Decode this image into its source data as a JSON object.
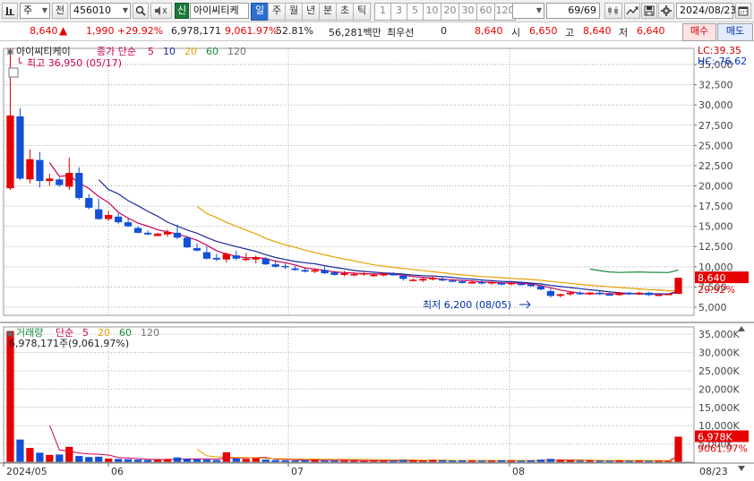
{
  "toolbar": {
    "left_icon": "chart-type-icon",
    "market_select": "주",
    "prev_btn": "전",
    "code": "456010",
    "sound_icon": "speaker-icon",
    "credit_badge": "신",
    "name": "아이씨티케",
    "periods": [
      "일",
      "주",
      "월",
      "년",
      "분",
      "초",
      "틱"
    ],
    "active_period": "일",
    "intervals": [
      "1",
      "3",
      "5",
      "10",
      "20",
      "30",
      "60",
      "120"
    ],
    "count": "69/69",
    "date": "2024/08/23"
  },
  "quote": {
    "price": "8,640",
    "arrow": "▲",
    "change": "1,990",
    "change_pct": "+29.92%",
    "volume": "6,978,171",
    "volume_ratio": "9,061.97%",
    "turnover": "52.81%",
    "amount": "56,281백만",
    "pref_label": "최우선",
    "pref_value": "0",
    "bid_price": "8,640",
    "open_label": "시",
    "open": "6,650",
    "high_label": "고",
    "high": "8,640",
    "low_label": "저",
    "low": "6,640",
    "buy_btn": "매수",
    "sell_btn": "매도"
  },
  "price_panel": {
    "title": "아이씨티케이",
    "ma_label": "종가 단순",
    "ma_periods": [
      "5",
      "10",
      "20",
      "60",
      "120"
    ],
    "ma_colors": [
      "#cc0055",
      "#1a2a9e",
      "#e6a000",
      "#1a8a3a",
      "#707070"
    ],
    "high_note": "최고 36,950 (05/17)",
    "low_note": "최저 6,200 (08/05)",
    "lc": "LC:39.35",
    "hc": "HC:-76.62",
    "y_ticks": [
      "35,000",
      "32,500",
      "30,000",
      "27,500",
      "25,000",
      "22,500",
      "20,000",
      "17,500",
      "15,000",
      "12,500",
      "10,000",
      "7,500",
      "5,000"
    ],
    "current_tag": "8,640",
    "current_pct": "29.92%"
  },
  "volume_panel": {
    "title": "거래량",
    "ma_label": "단순",
    "ma_periods": [
      "5",
      "20",
      "60",
      "120"
    ],
    "volume_note": "6,978,171주(9,061.97%)",
    "y_ticks": [
      "35,000K",
      "30,000K",
      "25,000K",
      "20,000K",
      "15,000K",
      "10,000K",
      "5,000K"
    ],
    "current_tag": "6,978K",
    "current_pct": "9061.97%"
  },
  "x_axis": {
    "labels": [
      "2024/05",
      "06",
      "07",
      "08"
    ],
    "right_label": "08/23"
  },
  "colors": {
    "up": "#e60000",
    "down": "#1150d8"
  },
  "chart_data": {
    "type": "candlestick",
    "title": "아이씨티케이",
    "x_labels": [
      "2024/05",
      "06",
      "07",
      "08"
    ],
    "price_ylim": [
      4000,
      37000
    ],
    "volume_ylim": [
      0,
      37000000
    ],
    "candles": [
      [
        19700,
        36950,
        19500,
        28700
      ],
      [
        28600,
        29600,
        20700,
        20900
      ],
      [
        20800,
        24500,
        20300,
        23300
      ],
      [
        23200,
        24200,
        19800,
        20600
      ],
      [
        20600,
        21500,
        20000,
        20900
      ],
      [
        20800,
        21000,
        19900,
        20100
      ],
      [
        19900,
        23500,
        19500,
        21600
      ],
      [
        21600,
        22300,
        18300,
        18500
      ],
      [
        18500,
        19000,
        17100,
        17300
      ],
      [
        17100,
        18400,
        15800,
        15900
      ],
      [
        15900,
        16900,
        15700,
        16400
      ],
      [
        16200,
        16600,
        15300,
        15500
      ],
      [
        15500,
        16000,
        14900,
        15000
      ],
      [
        14800,
        15000,
        14100,
        14200
      ],
      [
        14200,
        14500,
        13900,
        14000
      ],
      [
        13800,
        14200,
        13800,
        14100
      ],
      [
        14000,
        14600,
        13700,
        14300
      ],
      [
        14200,
        15200,
        13400,
        13600
      ],
      [
        13600,
        13800,
        12300,
        12400
      ],
      [
        12300,
        12900,
        11900,
        12000
      ],
      [
        11800,
        12500,
        10900,
        11000
      ],
      [
        11100,
        11600,
        10700,
        10900
      ],
      [
        10900,
        11800,
        10500,
        11600
      ],
      [
        11400,
        12000,
        10800,
        11000
      ],
      [
        10900,
        11700,
        10700,
        11000
      ],
      [
        10900,
        11400,
        10400,
        11200
      ],
      [
        11000,
        11200,
        10200,
        10300
      ],
      [
        10300,
        10800,
        9900,
        10000
      ],
      [
        10100,
        10400,
        9700,
        10000
      ],
      [
        9800,
        10100,
        9500,
        9600
      ],
      [
        9600,
        9800,
        9300,
        9400
      ],
      [
        9400,
        9800,
        9200,
        9600
      ],
      [
        9600,
        10000,
        9100,
        9200
      ],
      [
        9300,
        9500,
        8900,
        9000
      ],
      [
        9000,
        9500,
        8800,
        9200
      ],
      [
        9100,
        9300,
        8800,
        9100
      ],
      [
        9200,
        9400,
        8900,
        9200
      ],
      [
        9000,
        9200,
        8800,
        9000
      ],
      [
        9000,
        9300,
        8800,
        9100
      ],
      [
        9100,
        9300,
        8900,
        9000
      ],
      [
        8900,
        9100,
        8300,
        8500
      ],
      [
        8400,
        8600,
        8200,
        8400
      ],
      [
        8300,
        8600,
        8100,
        8500
      ],
      [
        8500,
        8800,
        8300,
        8600
      ],
      [
        8500,
        8700,
        8200,
        8300
      ],
      [
        8300,
        8500,
        8100,
        8200
      ],
      [
        8200,
        8400,
        7900,
        8000
      ],
      [
        8000,
        8300,
        7900,
        8100
      ],
      [
        8100,
        8300,
        7800,
        8000
      ],
      [
        8000,
        8200,
        7800,
        8100
      ],
      [
        8000,
        8100,
        7700,
        7800
      ],
      [
        7900,
        8100,
        7700,
        8000
      ],
      [
        7900,
        8000,
        7700,
        7800
      ],
      [
        7800,
        7900,
        7500,
        7600
      ],
      [
        7600,
        7700,
        7100,
        7200
      ],
      [
        7000,
        7300,
        6200,
        6400
      ],
      [
        6400,
        6700,
        6200,
        6600
      ],
      [
        6600,
        6900,
        6400,
        6800
      ],
      [
        6800,
        7000,
        6500,
        6600
      ],
      [
        6600,
        6900,
        6500,
        6800
      ],
      [
        6800,
        7000,
        6500,
        6600
      ],
      [
        6600,
        6800,
        6400,
        6500
      ],
      [
        6500,
        6900,
        6400,
        6800
      ],
      [
        6800,
        6900,
        6500,
        6600
      ],
      [
        6600,
        6900,
        6500,
        6800
      ],
      [
        6800,
        6900,
        6400,
        6500
      ],
      [
        6500,
        6700,
        6400,
        6550
      ],
      [
        6600,
        6700,
        6500,
        6650
      ],
      [
        6650,
        8640,
        6640,
        8640
      ]
    ],
    "volumes": [
      35800,
      6200,
      3900,
      2600,
      2000,
      2100,
      4200,
      1700,
      1400,
      1500,
      1000,
      900,
      800,
      700,
      600,
      700,
      900,
      1300,
      900,
      800,
      700,
      600,
      2700,
      1000,
      900,
      1100,
      700,
      600,
      500,
      450,
      500,
      700,
      450,
      400,
      500,
      450,
      400,
      380,
      420,
      400,
      600,
      500,
      450,
      600,
      500,
      450,
      500,
      450,
      420,
      430,
      500,
      450,
      420,
      500,
      700,
      900,
      600,
      500,
      400,
      450,
      420,
      380,
      500,
      400,
      450,
      380,
      400,
      350,
      6978
    ],
    "ma5_start": 4,
    "ma10_start": 9,
    "ma20_start": 19,
    "ma60_start": 59
  }
}
